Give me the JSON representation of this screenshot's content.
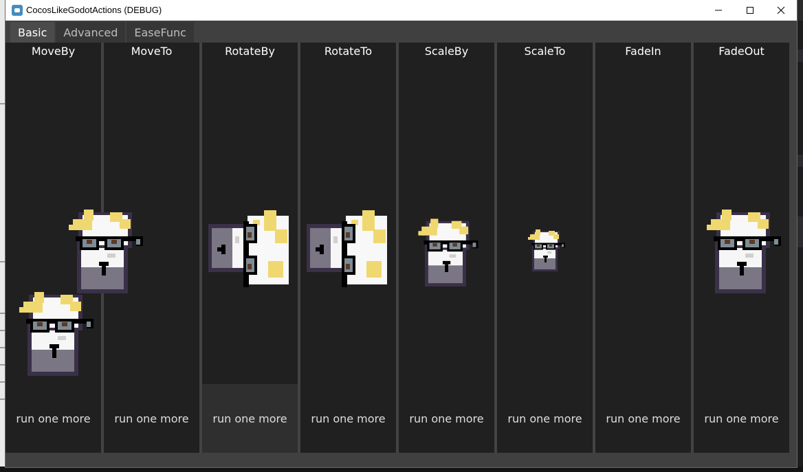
{
  "window": {
    "title": "CocosLikeGodotActions (DEBUG)",
    "controls": [
      "minimize",
      "maximize",
      "close"
    ]
  },
  "tabs": [
    {
      "label": "Basic",
      "active": true
    },
    {
      "label": "Advanced",
      "active": false
    },
    {
      "label": "EaseFunc",
      "active": false
    }
  ],
  "columns": [
    {
      "title": "MoveBy",
      "button": "run one more"
    },
    {
      "title": "MoveTo",
      "button": "run one more"
    },
    {
      "title": "RotateBy",
      "button": "run one more"
    },
    {
      "title": "RotateTo",
      "button": "run one more"
    },
    {
      "title": "ScaleBy",
      "button": "run one more"
    },
    {
      "title": "ScaleTo",
      "button": "run one more"
    },
    {
      "title": "FadeIn",
      "button": "run one more"
    },
    {
      "title": "FadeOut",
      "button": "run one more"
    }
  ],
  "colors": {
    "sprite_hair": "#f0d870",
    "sprite_face": "#f8f8f8",
    "sprite_body": "#7a7684",
    "sprite_outline": "#3a3048",
    "glasses": "#000000"
  }
}
